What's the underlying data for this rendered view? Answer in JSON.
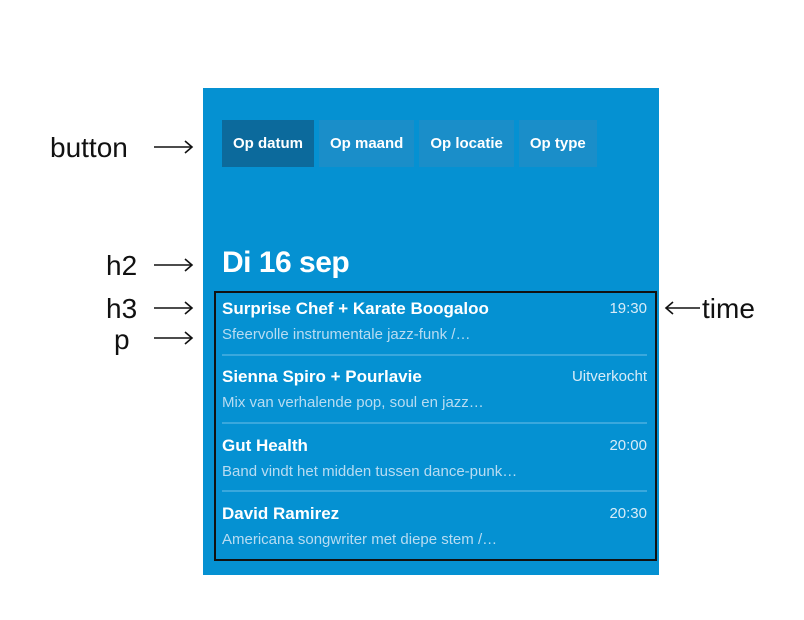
{
  "filters": [
    {
      "label": "Op datum",
      "active": true
    },
    {
      "label": "Op maand",
      "active": false
    },
    {
      "label": "Op locatie",
      "active": false
    },
    {
      "label": "Op type",
      "active": false
    }
  ],
  "day_heading": "Di 16 sep",
  "events": [
    {
      "title": "Surprise Chef + Karate Boogaloo",
      "time": "19:30",
      "description": "Sfeervolle instrumentale jazz-funk /…"
    },
    {
      "title": "Sienna Spiro + Pourlavie",
      "time": "Uitverkocht",
      "description": "Mix van verhalende pop, soul en jazz…"
    },
    {
      "title": "Gut Health",
      "time": "20:00",
      "description": "Band vindt het midden tussen dance-punk…"
    },
    {
      "title": "David Ramirez",
      "time": "20:30",
      "description": "Americana songwriter met diepe stem /…"
    }
  ],
  "annotations": {
    "button": "button",
    "h2": "h2",
    "h3": "h3",
    "p": "p",
    "time": "time"
  },
  "colors": {
    "panel": "#0591d2",
    "button": "#1a8ec9",
    "button_active": "#0c6a9c",
    "text": "#ffffff",
    "annotation": "#111111"
  }
}
